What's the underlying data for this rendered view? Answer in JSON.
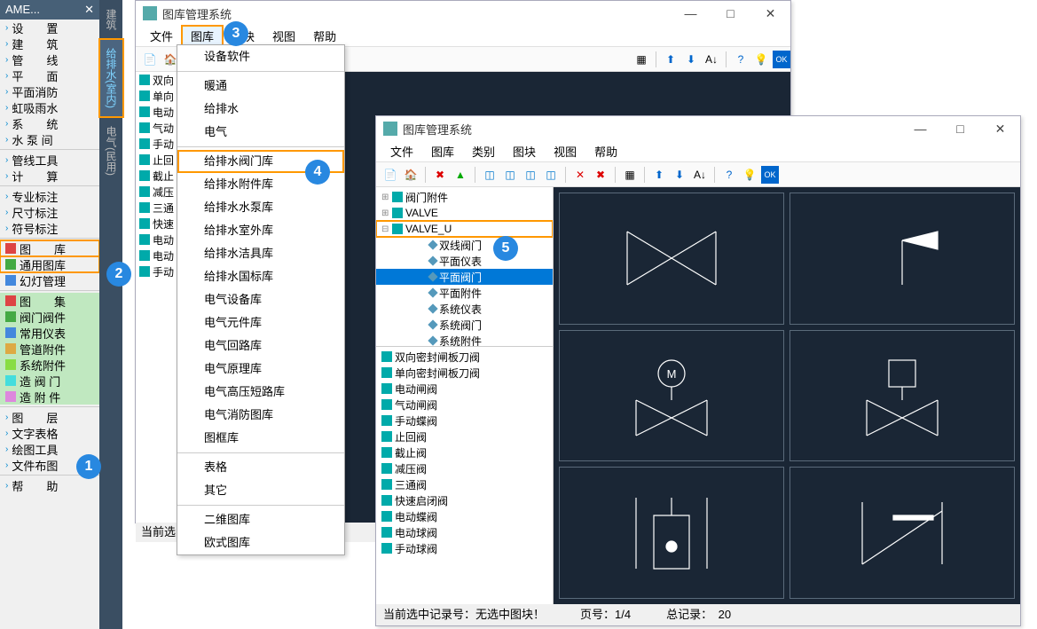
{
  "sidebar": {
    "title": "AME...",
    "items_top": [
      "设　　置",
      "建　　筑",
      "管　　线",
      "平　　面",
      "平面消防",
      "虹吸雨水",
      "系　　统",
      "水 泵 间"
    ],
    "items_mid1": [
      "管线工具",
      "计　　算"
    ],
    "items_mid2": [
      "专业标注",
      "尺寸标注",
      "符号标注"
    ],
    "items_lib": [
      "图　　库",
      "通用图库",
      "幻灯管理"
    ],
    "items_green": [
      "图　　集",
      "阀门阀件",
      "常用仪表",
      "管道附件",
      "系统附件",
      "造 阀 门",
      "造 附 件"
    ],
    "items_bot": [
      "图　　层",
      "文字表格",
      "绘图工具",
      "文件布图"
    ],
    "help": "帮　　助"
  },
  "vert_tabs": [
    "建筑",
    "给排水(室内)",
    "电气(民用)"
  ],
  "win1": {
    "title": "图库管理系统",
    "menu": [
      "文件",
      "图库",
      "图块",
      "视图",
      "帮助"
    ],
    "tree": [
      "双向",
      "单向",
      "电动",
      "气动",
      "手动",
      "止回",
      "截止",
      "减压",
      "三通",
      "快速",
      "电动",
      "电动",
      "手动"
    ],
    "status": "当前选"
  },
  "dropdown": {
    "groups": [
      [
        "设备软件"
      ],
      [
        "暖通",
        "给排水",
        "电气"
      ],
      [
        "给排水阀门库",
        "给排水附件库",
        "给排水水泵库",
        "给排水室外库",
        "给排水洁具库",
        "给排水国标库",
        "电气设备库",
        "电气元件库",
        "电气回路库",
        "电气原理库",
        "电气高压短路库",
        "电气消防图库",
        "图框库"
      ],
      [
        "表格",
        "其它"
      ],
      [
        "二维图库",
        "欧式图库"
      ]
    ]
  },
  "win2": {
    "title": "图库管理系统",
    "menu": [
      "文件",
      "图库",
      "类别",
      "图块",
      "视图",
      "帮助"
    ],
    "tree": [
      {
        "label": "阀门附件",
        "exp": "⊞",
        "cls": "folder"
      },
      {
        "label": "VALVE",
        "exp": "⊞",
        "cls": "folder"
      },
      {
        "label": "VALVE_U",
        "exp": "⊟",
        "cls": "folder",
        "hl": true
      },
      {
        "label": "双线阀门",
        "cls": "leaf",
        "indent": 2
      },
      {
        "label": "平面仪表",
        "cls": "leaf",
        "indent": 2
      },
      {
        "label": "平面阀门",
        "cls": "leaf",
        "indent": 2,
        "sel": true
      },
      {
        "label": "平面附件",
        "cls": "leaf",
        "indent": 2
      },
      {
        "label": "系统仪表",
        "cls": "leaf",
        "indent": 2
      },
      {
        "label": "系统阀门",
        "cls": "leaf",
        "indent": 2
      },
      {
        "label": "系统附件",
        "cls": "leaf",
        "indent": 2
      }
    ],
    "list": [
      "双向密封闸板刀阀",
      "单向密封闸板刀阀",
      "电动闸阀",
      "气动闸阀",
      "手动蝶阀",
      "止回阀",
      "截止阀",
      "减压阀",
      "三通阀",
      "快速启闭阀",
      "电动蝶阀",
      "电动球阀",
      "手动球阀"
    ],
    "status_sel": "当前选中记录号：无选中图块！",
    "status_page": "页号：1/4",
    "status_total": "总记录：　20"
  },
  "badges": [
    "1",
    "2",
    "3",
    "4",
    "5"
  ]
}
